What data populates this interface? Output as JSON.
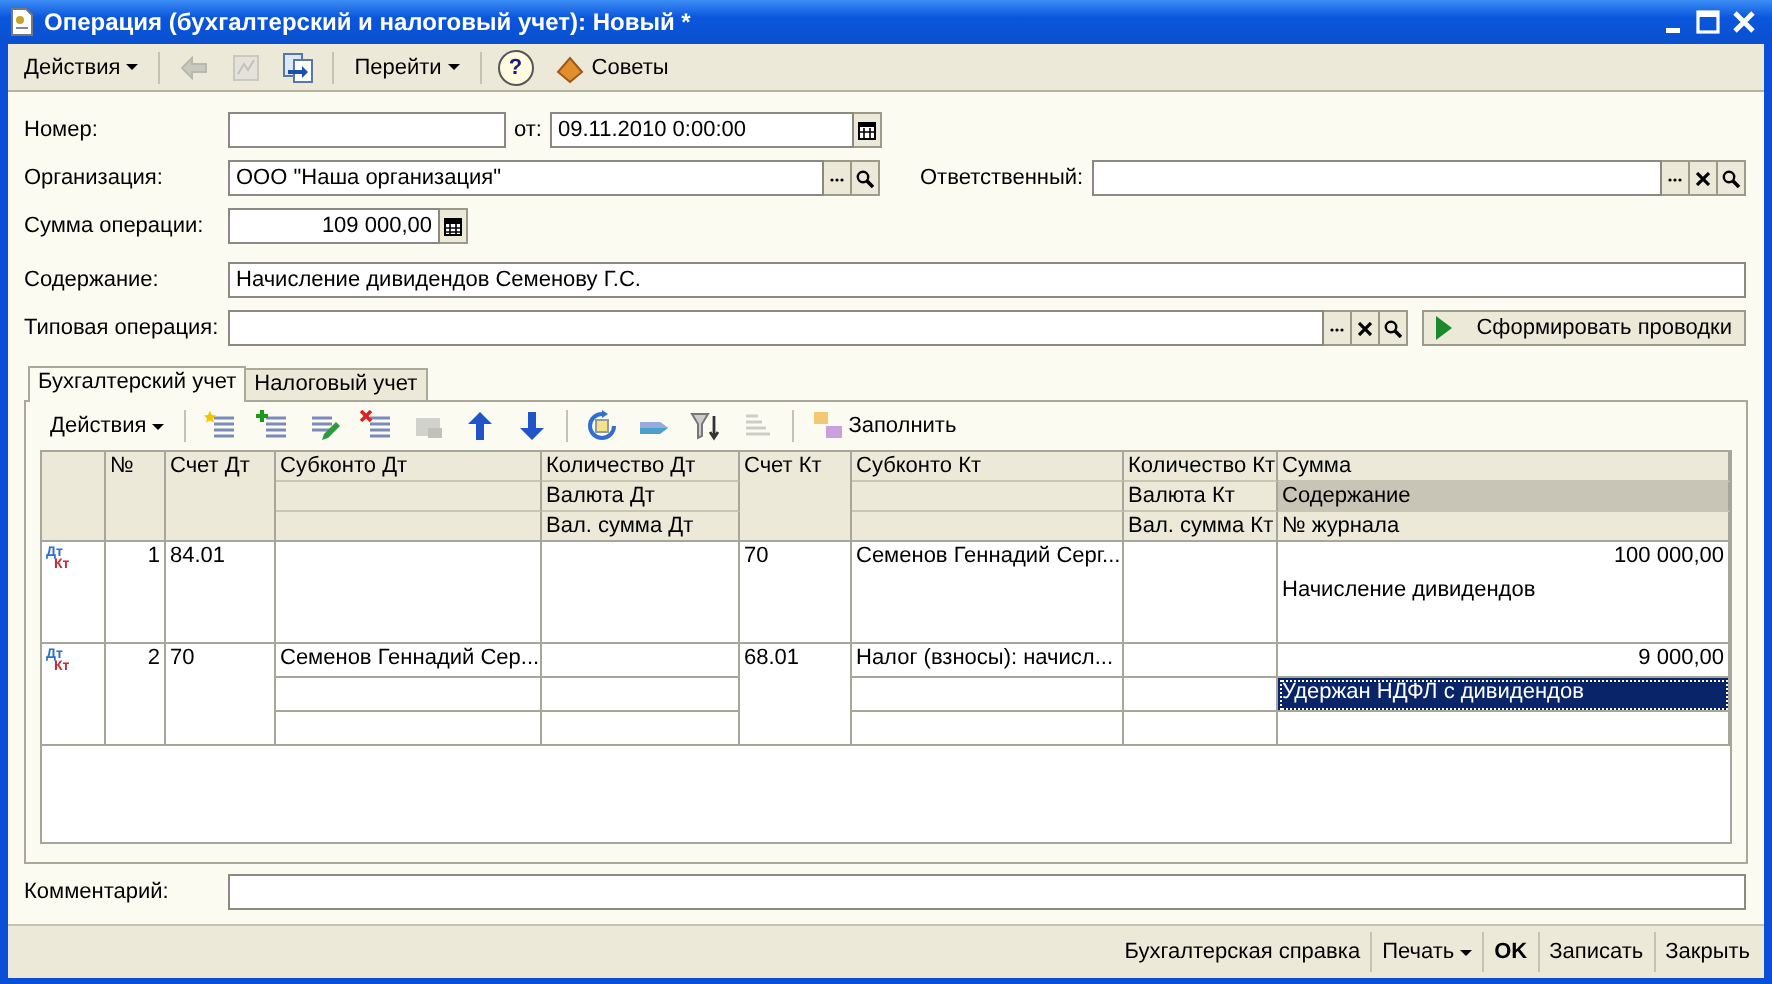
{
  "window": {
    "title": "Операция (бухгалтерский и налоговый учет): Новый *"
  },
  "toolbar": [
    {
      "kind": "menu",
      "label": "Действия"
    },
    {
      "kind": "separator"
    },
    {
      "kind": "icon",
      "disabled": true
    },
    {
      "kind": "icon",
      "disabled": true
    },
    {
      "kind": "icon",
      "disabled": false
    },
    {
      "kind": "separator"
    },
    {
      "kind": "menu",
      "label": "Перейти"
    },
    {
      "kind": "separator"
    },
    {
      "kind": "help",
      "label": "?"
    },
    {
      "kind": "button",
      "label": "Советы"
    }
  ],
  "form": {
    "number": {
      "label": "Номер:"
    },
    "date": {
      "label": "от:",
      "value": "09.11.2010  0:00:00"
    },
    "organization": {
      "label": "Организация:",
      "value": "ООО \"Наша организация\""
    },
    "responsible": {
      "label": "Ответственный:"
    },
    "amount": {
      "label": "Сумма операции:",
      "value": "109 000,00"
    },
    "content": {
      "label": "Содержание:",
      "value": "Начисление дивидендов  Семенову Г.С."
    },
    "typical": {
      "label": "Типовая операция:"
    },
    "generate_button": "Сформировать проводки"
  },
  "tabs": [
    {
      "label": "Бухгалтерский учет",
      "selected": true
    },
    {
      "label": "Налоговый учет",
      "selected": false
    }
  ],
  "grid_toolbar": [
    {
      "kind": "menu",
      "label": "Действия"
    },
    {
      "kind": "separator"
    },
    {
      "kind": "icon",
      "disabled": false
    },
    {
      "kind": "icon",
      "disabled": false
    },
    {
      "kind": "icon",
      "disabled": false
    },
    {
      "kind": "icon",
      "disabled": false
    },
    {
      "kind": "icon",
      "disabled": true
    },
    {
      "kind": "icon",
      "disabled": false
    },
    {
      "kind": "icon",
      "disabled": false
    },
    {
      "kind": "separator"
    },
    {
      "kind": "icon",
      "disabled": false
    },
    {
      "kind": "icon",
      "disabled": false
    },
    {
      "kind": "icon",
      "disabled": false
    },
    {
      "kind": "icon",
      "disabled": true
    },
    {
      "kind": "separator"
    },
    {
      "kind": "button",
      "label": "Заполнить"
    }
  ],
  "table": {
    "columns": [
      {
        "kind": "number",
        "split": false,
        "subs": [
          {
            "header": "№",
            "highlighted": false
          }
        ]
      },
      {
        "kind": "text",
        "split": false,
        "subs": [
          {
            "header": "Счет Дт",
            "highlighted": false
          }
        ]
      },
      {
        "kind": "text",
        "split": true,
        "subs": [
          {
            "header": "Субконто Дт",
            "highlighted": false
          }
        ]
      },
      {
        "kind": "text",
        "split": true,
        "subs": [
          {
            "header": "Количество Дт",
            "highlighted": false
          },
          {
            "header": "Валюта Дт",
            "highlighted": false
          },
          {
            "header": "Вал. сумма Дт",
            "highlighted": false
          }
        ]
      },
      {
        "kind": "text",
        "split": false,
        "subs": [
          {
            "header": "Счет Кт",
            "highlighted": false
          }
        ]
      },
      {
        "kind": "text",
        "split": true,
        "subs": [
          {
            "header": "Субконто Кт",
            "highlighted": false
          }
        ]
      },
      {
        "kind": "text",
        "split": true,
        "subs": [
          {
            "header": "Количество Кт",
            "highlighted": false
          },
          {
            "header": "Валюта Кт",
            "highlighted": false
          },
          {
            "header": "Вал. сумма Кт",
            "highlighted": false
          }
        ]
      },
      {
        "kind": "amount",
        "split": true,
        "subs": [
          {
            "header": "Сумма",
            "highlighted": false
          },
          {
            "header": "Содержание",
            "highlighted": true
          },
          {
            "header": "№ журнала",
            "highlighted": false
          }
        ]
      }
    ],
    "rows": [
      {
        "selected": false,
        "marker": {
          "debit": "Дт",
          "credit": "Кт"
        },
        "cells": [
          {
            "lines": [
              "1"
            ]
          },
          {
            "lines": [
              "84.01"
            ]
          },
          {},
          {},
          {
            "lines": [
              "70"
            ]
          },
          {
            "lines": [
              "Семенов Геннадий Серг..."
            ]
          },
          {},
          {
            "lines": [
              "100 000,00",
              "Начисление дивидендов"
            ]
          }
        ]
      },
      {
        "selected": true,
        "marker": {
          "debit": "Дт",
          "credit": "Кт"
        },
        "cells": [
          {
            "lines": [
              "2"
            ]
          },
          {
            "lines": [
              "70"
            ]
          },
          {
            "lines": [
              "Семенов Геннадий Сер..."
            ]
          },
          {},
          {
            "lines": [
              "68.01"
            ]
          },
          {
            "lines": [
              "Налог (взносы): начисл..."
            ]
          },
          {},
          {
            "lines": [
              "9 000,00",
              "Удержан НДФЛ с дивидендов"
            ]
          }
        ]
      }
    ]
  },
  "comment": {
    "label": "Комментарий:"
  },
  "footer": [
    {
      "kind": "link",
      "label": "Бухгалтерская справка"
    },
    {
      "kind": "menu",
      "label": "Печать"
    },
    {
      "kind": "default",
      "label": "OK"
    },
    {
      "kind": "button",
      "label": "Записать"
    },
    {
      "kind": "button",
      "label": "Закрыть"
    }
  ]
}
